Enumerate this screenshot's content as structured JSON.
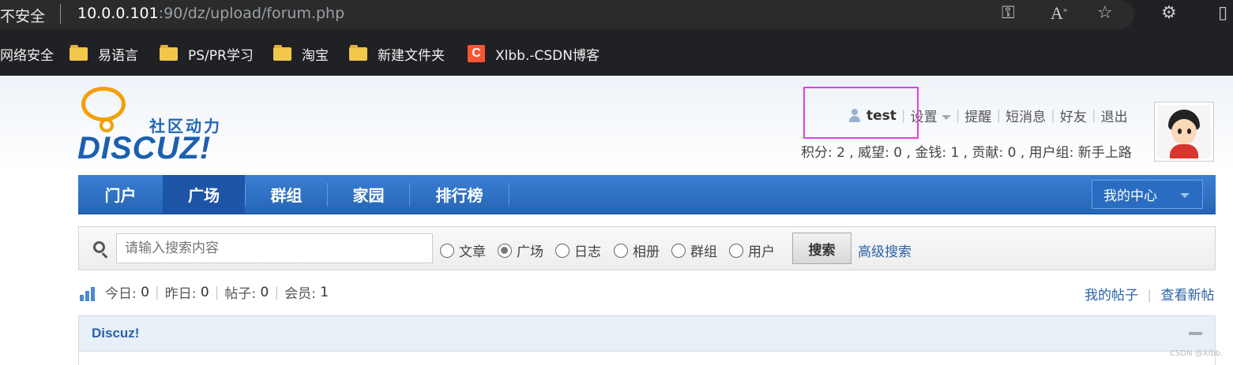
{
  "browser": {
    "insecure_label": "不安全",
    "url_host": "10.0.0.101",
    "url_rest": ":90/dz/upload/forum.php",
    "icons": [
      "key-icon",
      "read-aloud-icon",
      "favorite-star-icon",
      "extensions-icon",
      "split-view-icon"
    ],
    "bookmarks": [
      {
        "label": "网络安全",
        "icon": "none"
      },
      {
        "label": "易语言",
        "icon": "folder-icon"
      },
      {
        "label": "PS/PR学习",
        "icon": "folder-icon"
      },
      {
        "label": "淘宝",
        "icon": "folder-icon"
      },
      {
        "label": "新建文件夹",
        "icon": "folder-icon"
      },
      {
        "label": "Xlbb.-CSDN博客",
        "icon": "csdn-icon",
        "icon_letter": "C"
      }
    ]
  },
  "header": {
    "logo_tagline": "社区动力",
    "logo_word": "DISCUZ!",
    "username": "test",
    "links": [
      "设置",
      "提醒",
      "短消息",
      "好友",
      "退出"
    ],
    "stats_line": "积分: 2 , 威望: 0 , 金钱: 1 , 贡献: 0 , 用户组: 新手上路"
  },
  "nav": {
    "items": [
      "门户",
      "广场",
      "群组",
      "家园",
      "排行榜"
    ],
    "active": "广场",
    "my_center": "我的中心"
  },
  "search": {
    "placeholder": "请输入搜索内容",
    "options": [
      "文章",
      "广场",
      "日志",
      "相册",
      "群组",
      "用户"
    ],
    "selected": "广场",
    "button": "搜索",
    "advanced": "高级搜索"
  },
  "stats": {
    "today_label": "今日:",
    "today": "0",
    "yesterday_label": "昨日:",
    "yesterday": "0",
    "posts_label": "帖子:",
    "posts": "0",
    "members_label": "会员:",
    "members": "1"
  },
  "my_links": [
    "我的帖子",
    "查看新帖"
  ],
  "forum_box": {
    "title": "Discuz!"
  },
  "watermark": "CSDN @Xlbb.",
  "colors": {
    "nav_blue": "#2565b5",
    "link_blue": "#2b61a8",
    "highlight_magenta": "#e83ce8",
    "logo_orange": "#f2a007"
  }
}
